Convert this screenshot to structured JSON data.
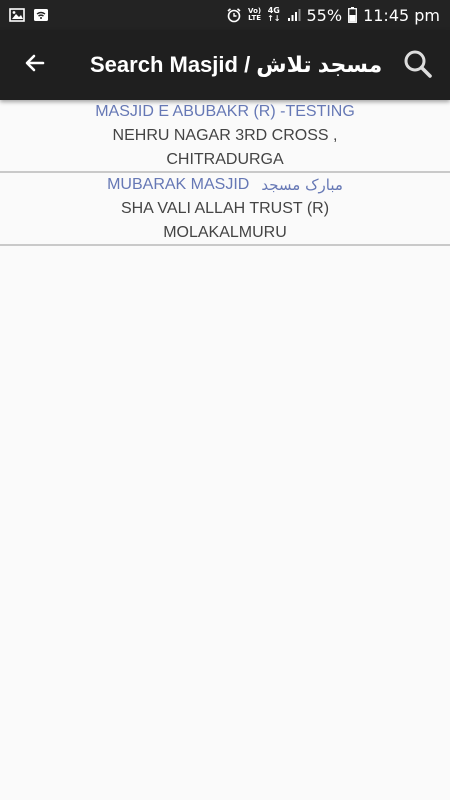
{
  "status_bar": {
    "left_icons": [
      "image-icon",
      "wifi-icon"
    ],
    "alarm_icon": "alarm-icon",
    "volte_top": "Vo)",
    "volte_bottom": "LTE",
    "network_top": "4G",
    "network_bottom": "↑↓",
    "battery_percent": "55%",
    "time": "11:45 pm"
  },
  "app_bar": {
    "back_icon": "arrow-back-icon",
    "title": "Search Masjid / مسجد تلاش",
    "search_icon": "search-icon"
  },
  "results": [
    {
      "name": "MASJID E ABUBAKR (R) -TESTING",
      "urdu": "",
      "line1": "NEHRU NAGAR 3RD CROSS ,",
      "line2": "CHITRADURGA"
    },
    {
      "name": "MUBARAK MASJID",
      "urdu": "مبارک مسجد",
      "line1": "SHA VALI ALLAH TRUST (R)",
      "line2": "MOLAKALMURU"
    }
  ],
  "colors": {
    "status_bar_bg": "#232323",
    "app_bar_bg": "#1f1f1f",
    "link_blue": "#6678b5",
    "body_text": "#444444",
    "divider": "#c9c9c9",
    "page_bg": "#fafafa"
  }
}
